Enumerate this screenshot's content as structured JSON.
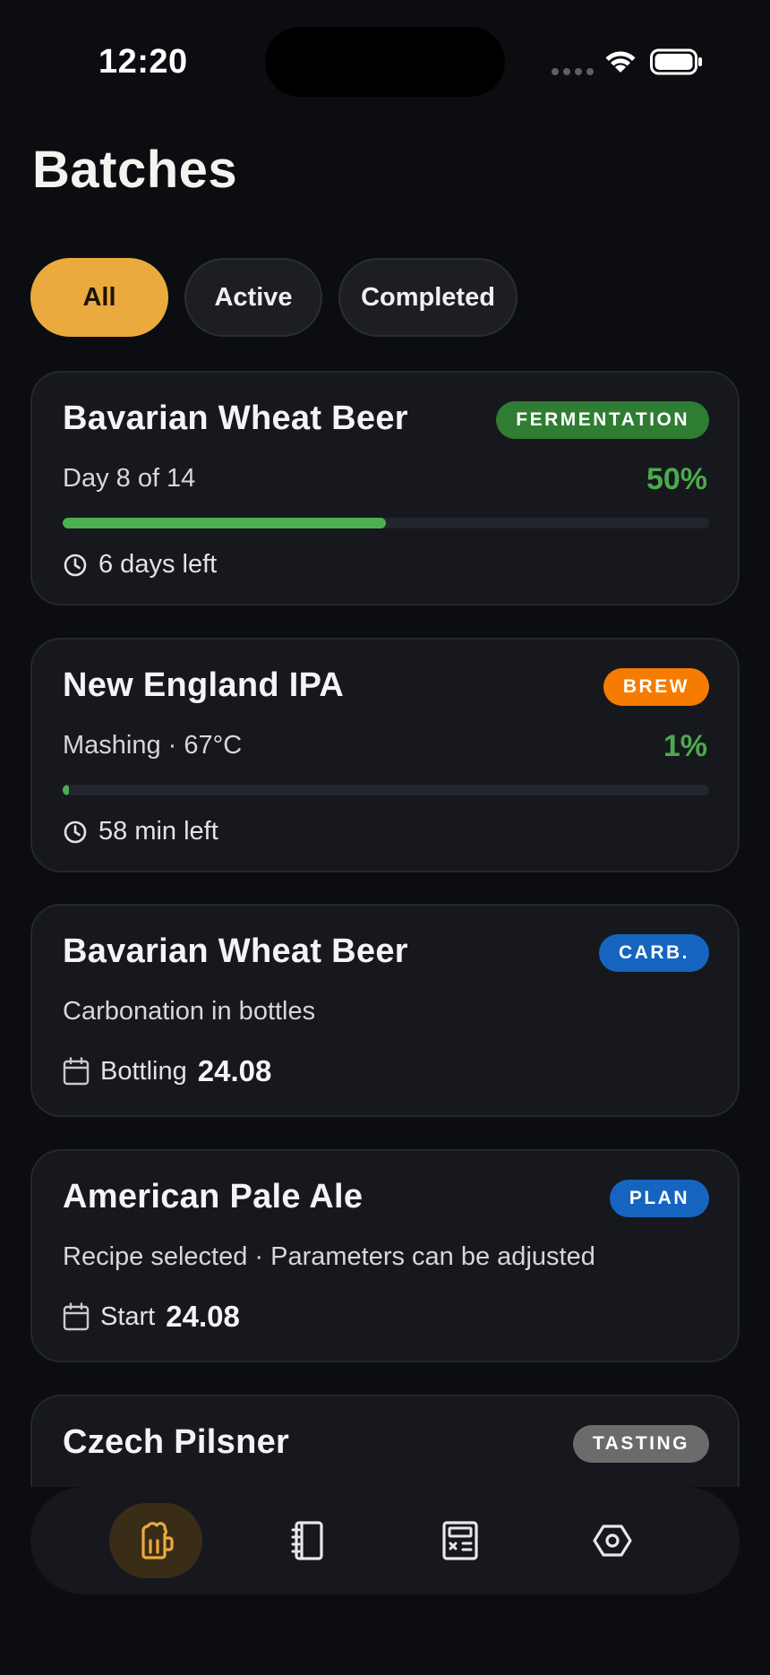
{
  "status_bar": {
    "time": "12:20"
  },
  "page": {
    "title": "Batches"
  },
  "filters": [
    {
      "label": "All",
      "selected": true
    },
    {
      "label": "Active",
      "selected": false
    },
    {
      "label": "Completed",
      "selected": false
    }
  ],
  "batches": [
    {
      "name": "Bavarian Wheat Beer",
      "badge": "FERMENTATION",
      "badge_color": "#2e7d32",
      "subtitle": "Day 8 of 14",
      "percent_label": "50%",
      "progress": 0.5,
      "meta_icon": "clock-icon",
      "meta_text": "6 days left"
    },
    {
      "name": "New England IPA",
      "badge": "BREW",
      "badge_color": "#f57c00",
      "subtitle": "Mashing · 67°C",
      "percent_label": "1%",
      "progress": 0.01,
      "meta_icon": "clock-icon",
      "meta_text": "58 min left"
    },
    {
      "name": "Bavarian Wheat Beer",
      "badge": "CARB.",
      "badge_color": "#1565c0",
      "subtitle": "Carbonation in bottles",
      "meta_icon": "calendar-icon",
      "meta_label": "Bottling",
      "meta_value": "24.08"
    },
    {
      "name": "American Pale Ale",
      "badge": "PLAN",
      "badge_color": "#1565c0",
      "subtitle": "Recipe selected · Parameters can be adjusted",
      "meta_icon": "calendar-icon",
      "meta_label": "Start",
      "meta_value": "24.08"
    },
    {
      "name": "Czech Pilsner",
      "badge": "TASTING",
      "badge_color": "#6b6b6b"
    }
  ],
  "tabbar": {
    "tabs": [
      {
        "icon": "beer-mug-icon",
        "selected": true
      },
      {
        "icon": "recipe-book-icon",
        "selected": false
      },
      {
        "icon": "calculator-icon",
        "selected": false
      },
      {
        "icon": "settings-hex-icon",
        "selected": false
      }
    ],
    "accent": "#ebaa3e"
  }
}
